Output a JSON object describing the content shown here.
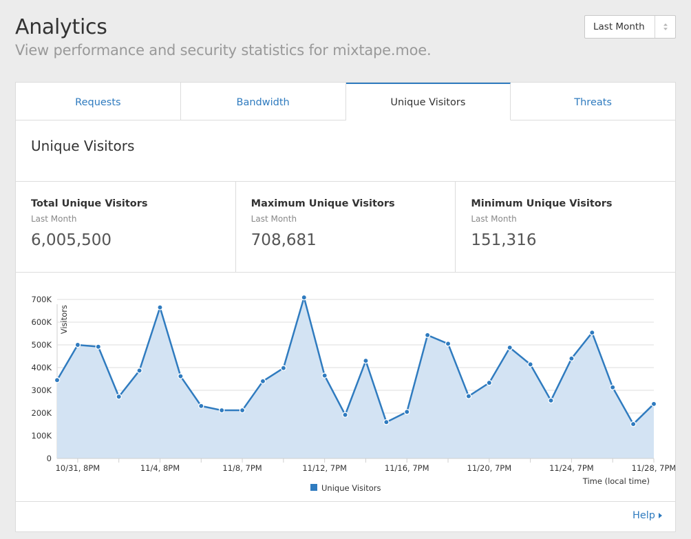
{
  "header": {
    "title": "Analytics",
    "subtitle": "View performance and security statistics for mixtape.moe."
  },
  "period_select": {
    "value": "Last Month",
    "icon": "up-down-caret-icon"
  },
  "tabs": [
    {
      "label": "Requests",
      "active": false
    },
    {
      "label": "Bandwidth",
      "active": false
    },
    {
      "label": "Unique Visitors",
      "active": true
    },
    {
      "label": "Threats",
      "active": false
    }
  ],
  "section": {
    "title": "Unique Visitors"
  },
  "stats": [
    {
      "label": "Total Unique Visitors",
      "period": "Last Month",
      "value": "6,005,500"
    },
    {
      "label": "Maximum Unique Visitors",
      "period": "Last Month",
      "value": "708,681"
    },
    {
      "label": "Minimum Unique Visitors",
      "period": "Last Month",
      "value": "151,316"
    }
  ],
  "chart_data": {
    "type": "area",
    "ylabel": "Visitors",
    "xlabel": "Time (local time)",
    "ylim": [
      0,
      700000
    ],
    "yticks": [
      0,
      100000,
      200000,
      300000,
      400000,
      500000,
      600000,
      700000
    ],
    "ytick_labels": [
      "0",
      "100K",
      "200K",
      "300K",
      "400K",
      "500K",
      "600K",
      "700K"
    ],
    "xtick_labels": [
      "10/31, 8PM",
      "11/4, 8PM",
      "11/8, 7PM",
      "11/12, 7PM",
      "11/16, 7PM",
      "11/20, 7PM",
      "11/24, 7PM",
      "11/28, 7PM"
    ],
    "xtick_positions": [
      1,
      5,
      9,
      13,
      17,
      21,
      25,
      29
    ],
    "grid": true,
    "legend_position": "bottom-center",
    "series": [
      {
        "name": "Unique Visitors",
        "color": "#2f7bbf",
        "fill": "#d3e3f3",
        "values": [
          345000,
          500000,
          492000,
          272000,
          387000,
          665000,
          362000,
          231000,
          212000,
          212000,
          340000,
          398000,
          708681,
          365000,
          192000,
          430000,
          160000,
          205000,
          543000,
          505000,
          274000,
          333000,
          488000,
          414000,
          255000,
          440000,
          554000,
          313000,
          151316,
          240000
        ]
      }
    ]
  },
  "footer": {
    "help_label": "Help",
    "help_icon": "caret-right-icon"
  }
}
